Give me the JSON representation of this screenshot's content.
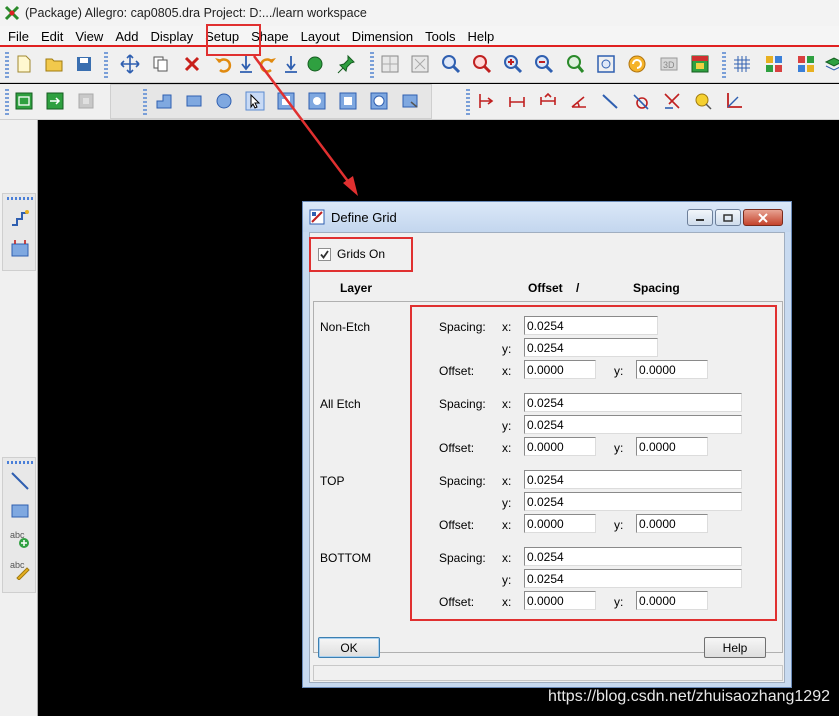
{
  "window": {
    "title": "(Package) Allegro: cap0805.dra  Project: D:.../learn workspace"
  },
  "menu": {
    "items": [
      {
        "label": "File"
      },
      {
        "label": "Edit"
      },
      {
        "label": "View"
      },
      {
        "label": "Add"
      },
      {
        "label": "Display"
      },
      {
        "label": "Setup"
      },
      {
        "label": "Shape"
      },
      {
        "label": "Layout"
      },
      {
        "label": "Dimension"
      },
      {
        "label": "Tools"
      },
      {
        "label": "Help"
      }
    ]
  },
  "colors": {
    "highlight": "#e03030",
    "canvas": "#000000"
  },
  "dialog": {
    "title": "Define Grid",
    "grids_on_label": "Grids On",
    "grids_on_checked": true,
    "headers": {
      "layer": "Layer",
      "offset": "Offset",
      "slash": "/",
      "spacing": "Spacing"
    },
    "labels": {
      "spacing": "Spacing:",
      "offset": "Offset:",
      "x": "x:",
      "y": "y:"
    },
    "layers": [
      {
        "name": "Non-Etch",
        "spacing_x": "0.0254",
        "spacing_y": "0.0254",
        "offset_x": "0.0000",
        "offset_y": "0.0000"
      },
      {
        "name": "All Etch",
        "spacing_x": "0.0254",
        "spacing_y": "0.0254",
        "offset_x": "0.0000",
        "offset_y": "0.0000"
      },
      {
        "name": "TOP",
        "spacing_x": "0.0254",
        "spacing_y": "0.0254",
        "offset_x": "0.0000",
        "offset_y": "0.0000"
      },
      {
        "name": "BOTTOM",
        "spacing_x": "0.0254",
        "spacing_y": "0.0254",
        "offset_x": "0.0000",
        "offset_y": "0.0000"
      }
    ],
    "ok_label": "OK",
    "help_label": "Help"
  },
  "watermark": "https://blog.csdn.net/zhuisaozhang1292"
}
